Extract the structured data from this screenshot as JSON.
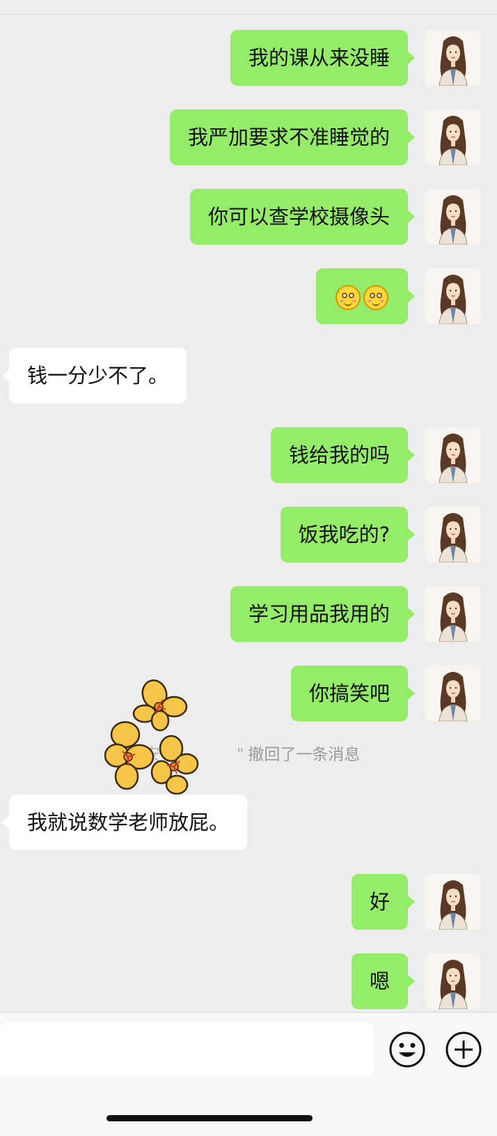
{
  "chat": {
    "messages": [
      {
        "side": "out",
        "text": "我的课从来没睡"
      },
      {
        "side": "out",
        "text": "我严加要求不准睡觉的"
      },
      {
        "side": "out",
        "text": "你可以查学校摄像头"
      },
      {
        "side": "out",
        "emojis": [
          "smiling-face-emoji",
          "smiling-face-emoji"
        ]
      },
      {
        "side": "in",
        "text": "钱一分少不了。"
      },
      {
        "side": "out",
        "text": "钱给我的吗"
      },
      {
        "side": "out",
        "text": "饭我吃的?"
      },
      {
        "side": "out",
        "text": "学习用品我用的"
      },
      {
        "side": "out",
        "text": "你搞笑吧"
      },
      {
        "side": "in",
        "text": "我就说数学老师放屁。"
      },
      {
        "side": "out",
        "text": "好"
      },
      {
        "side": "out",
        "text": "嗯"
      }
    ],
    "recall_notice": {
      "name_fragment": "\"安",
      "name_end": "\"",
      "text": "撤回了一条消息"
    }
  },
  "input_bar": {
    "emoji_button_icon": "smiley-face-icon",
    "more_button_icon": "plus-circle-icon"
  },
  "colors": {
    "outgoing_bubble": "#95ec69",
    "incoming_bubble": "#ffffff",
    "background": "#ededed"
  }
}
